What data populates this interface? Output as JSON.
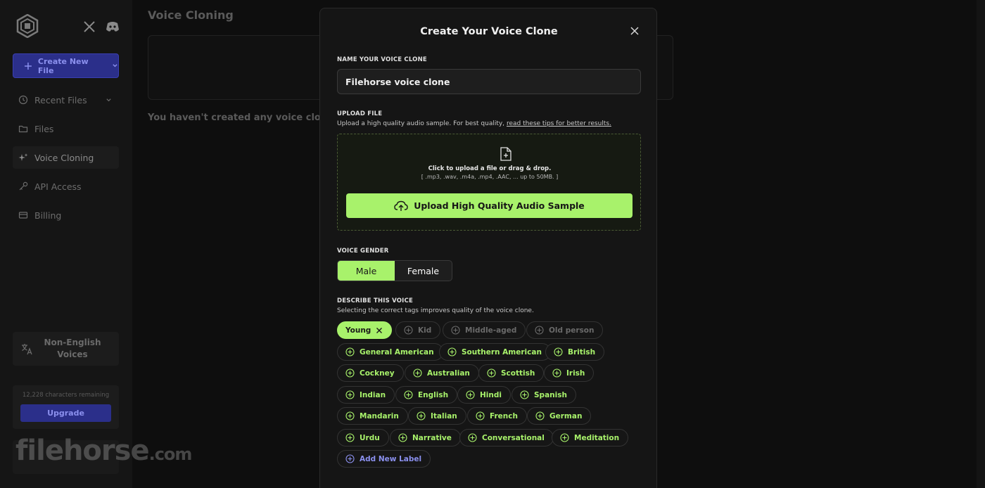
{
  "sidebar": {
    "create_button": "Create New File",
    "items": [
      {
        "label": "Recent Files"
      },
      {
        "label": "Files"
      },
      {
        "label": "Voice Cloning"
      },
      {
        "label": "API Access"
      },
      {
        "label": "Billing"
      }
    ],
    "non_english": "Non-English Voices",
    "credits_text": "12,228 characters remaining",
    "upgrade_button": "Upgrade",
    "watermark": "filehorse",
    "watermark_suffix": ".com"
  },
  "main": {
    "title": "Voice Cloning",
    "empty_message": "You haven't created any voice clones yet"
  },
  "modal": {
    "title": "Create Your Voice Clone",
    "name_label": "NAME YOUR VOICE CLONE",
    "name_value": "Filehorse voice clone",
    "upload_label": "UPLOAD FILE",
    "upload_hint": "Upload a high quality audio sample. For best quality,",
    "upload_hint_link": "read these tips for better results.",
    "dropzone_line1": "Click to upload a file or drag & drop.",
    "dropzone_line2": "[ .mp3, .wav, .m4a, .mp4, .AAC, ... up to 50MB. ]",
    "upload_button": "Upload High Quality Audio Sample",
    "gender_label": "VOICE GENDER",
    "gender_options": [
      "Male",
      "Female"
    ],
    "gender_selected": "Male",
    "describe_label": "DESCRIBE THIS VOICE",
    "describe_hint": "Selecting the correct tags improves quality of the voice clone.",
    "tags_row1": [
      "Young",
      "Kid",
      "Middle-aged",
      "Old person"
    ],
    "tags_row2": [
      "General American",
      "Southern American",
      "British"
    ],
    "tags_row3": [
      "Cockney",
      "Australian",
      "Scottish",
      "Irish"
    ],
    "tags_row4": [
      "Indian",
      "English",
      "Hindi",
      "Spanish"
    ],
    "tags_row5": [
      "Mandarin",
      "Italian",
      "French",
      "German"
    ],
    "tags_row6": [
      "Urdu",
      "Narrative",
      "Conversational",
      "Meditation"
    ],
    "add_label": "Add New Label"
  },
  "colors": {
    "accent_green": "#a8f26b",
    "accent_purple": "#8b90ee",
    "background": "#0e0e0e"
  }
}
